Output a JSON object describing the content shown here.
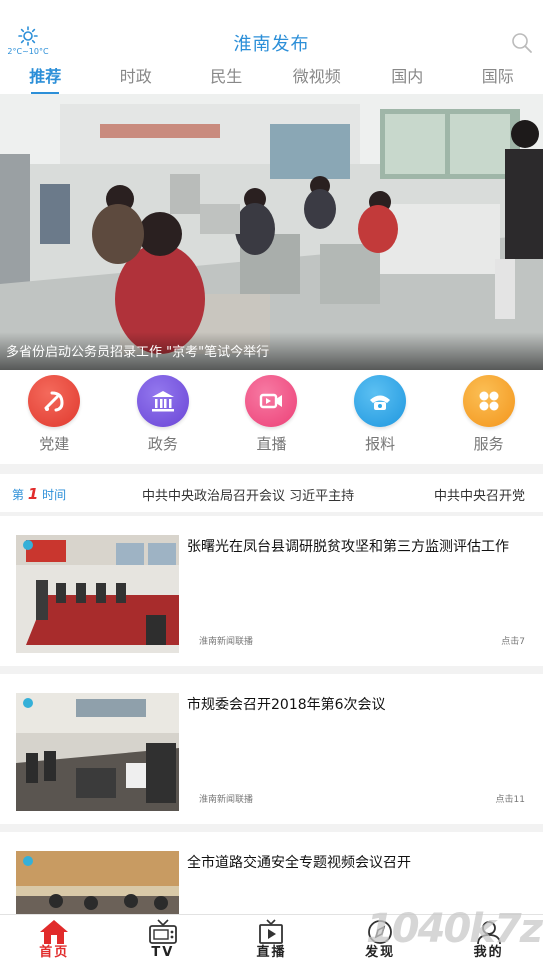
{
  "header": {
    "title": "淮南发布",
    "weather_icon": "sun-icon",
    "temperature": "2°C~10°C",
    "search_icon": "search-icon"
  },
  "tabs": [
    {
      "label": "推荐",
      "active": true
    },
    {
      "label": "时政",
      "active": false
    },
    {
      "label": "民生",
      "active": false
    },
    {
      "label": "微视频",
      "active": false
    },
    {
      "label": "国内",
      "active": false
    },
    {
      "label": "国际",
      "active": false
    }
  ],
  "banner": {
    "caption": "多省份启动公务员招录工作 \"京考\"笔试今举行"
  },
  "quicknav": [
    {
      "label": "党建",
      "icon": "party-emblem-icon",
      "color": "#e8473c"
    },
    {
      "label": "政务",
      "icon": "government-building-icon",
      "color": "#7a58e0"
    },
    {
      "label": "直播",
      "icon": "live-camera-icon",
      "color": "#f0508a"
    },
    {
      "label": "报料",
      "icon": "phone-icon",
      "color": "#2ea7e8"
    },
    {
      "label": "服务",
      "icon": "service-grid-icon",
      "color": "#f5a52a"
    }
  ],
  "ticker": {
    "brand_prefix": "第",
    "brand_number": "1",
    "brand_suffix": "时间",
    "item1": "中共中央政治局召开会议 习近平主持",
    "item2": "中共中央召开党"
  },
  "news": [
    {
      "title": "张曙光在凤台县调研脱贫攻坚和第三方监测评估工作",
      "source": "淮南新闻联播",
      "clicks": "点击7"
    },
    {
      "title": "市规委会召开2018年第6次会议",
      "source": "淮南新闻联播",
      "clicks": "点击11"
    },
    {
      "title": "全市道路交通安全专题视频会议召开",
      "source": "",
      "clicks": ""
    }
  ],
  "tabbar": [
    {
      "label": "首页",
      "icon": "home-icon",
      "active": true
    },
    {
      "label": "TV",
      "icon": "tv-icon",
      "active": false
    },
    {
      "label": "直播",
      "icon": "live-tv-icon",
      "active": false
    },
    {
      "label": "发现",
      "icon": "compass-icon",
      "active": false
    },
    {
      "label": "我的",
      "icon": "user-icon",
      "active": false
    }
  ],
  "colors": {
    "accent": "#2c8fd8",
    "active_red": "#e12b2b"
  },
  "watermark": "1040k7z"
}
